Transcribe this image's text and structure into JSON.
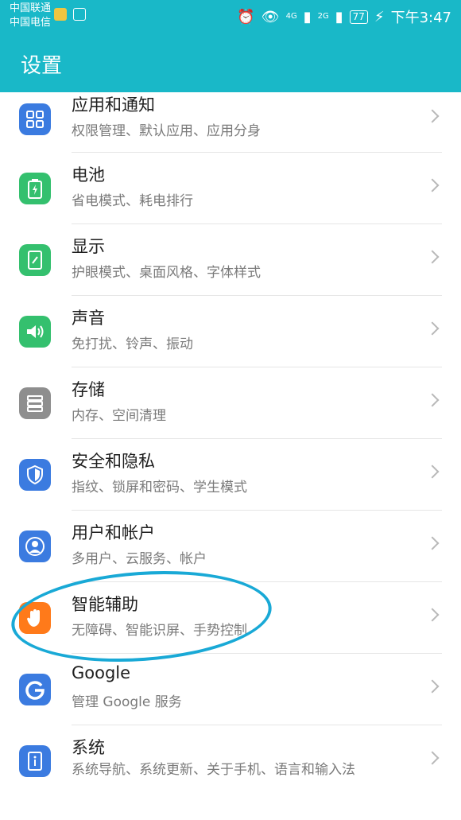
{
  "statusbar": {
    "carrier1": "中国联通",
    "carrier2": "中国电信",
    "net1": "4G",
    "net2": "2G",
    "battery": "77",
    "time": "下午3:47"
  },
  "appbar": {
    "title": "设置"
  },
  "items": [
    {
      "title": "应用和通知",
      "subtitle": "权限管理、默认应用、应用分身",
      "color": "#3b7be0"
    },
    {
      "title": "电池",
      "subtitle": "省电模式、耗电排行",
      "color": "#34c06e"
    },
    {
      "title": "显示",
      "subtitle": "护眼模式、桌面风格、字体样式",
      "color": "#34c06e"
    },
    {
      "title": "声音",
      "subtitle": "免打扰、铃声、振动",
      "color": "#34c06e"
    },
    {
      "title": "存储",
      "subtitle": "内存、空间清理",
      "color": "#8e8e8e"
    },
    {
      "title": "安全和隐私",
      "subtitle": "指纹、锁屏和密码、学生模式",
      "color": "#3b7be0"
    },
    {
      "title": "用户和帐户",
      "subtitle": "多用户、云服务、帐户",
      "color": "#3b7be0"
    },
    {
      "title": "智能辅助",
      "subtitle": "无障碍、智能识屏、手势控制",
      "color": "#ff7a1a"
    },
    {
      "title": "Google",
      "subtitle": "管理 Google 服务",
      "color": "#3b7be0"
    },
    {
      "title": "系统",
      "subtitle": "系统导航、系统更新、关于手机、语言和输入法",
      "color": "#3b7be0"
    }
  ]
}
